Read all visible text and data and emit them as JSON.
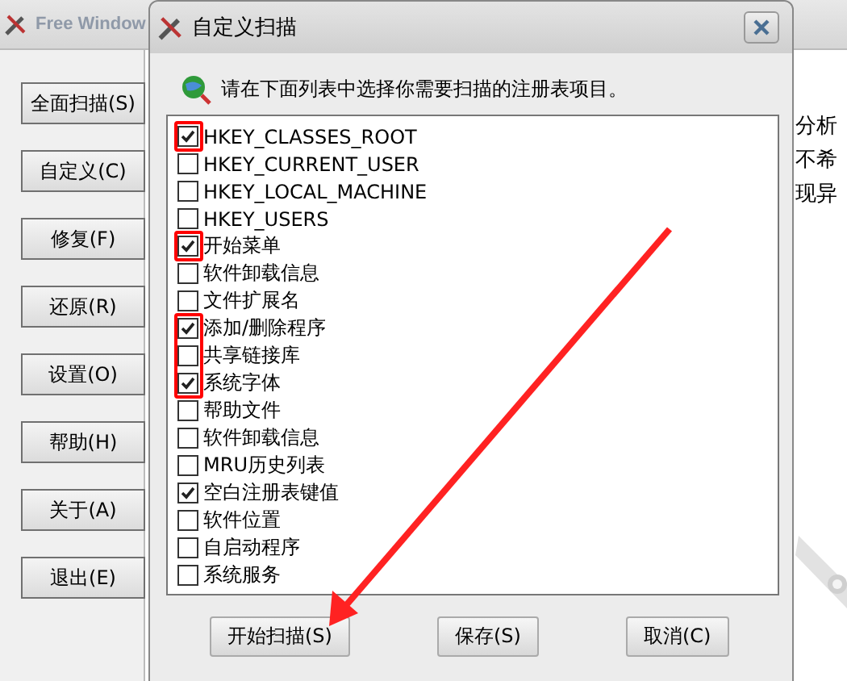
{
  "main_window": {
    "title": "Free Window",
    "buttons": [
      "全面扫描(S)",
      "自定义(C)",
      "修复(F)",
      "还原(R)",
      "设置(O)",
      "帮助(H)",
      "关于(A)",
      "退出(E)"
    ],
    "text_lines": [
      "分析",
      "不希",
      "现异"
    ]
  },
  "dialog": {
    "title": "自定义扫描",
    "instruction": "请在下面列表中选择你需要扫描的注册表项目。",
    "items": [
      {
        "label": "HKEY_CLASSES_ROOT",
        "checked": true,
        "highlighted": true
      },
      {
        "label": "HKEY_CURRENT_USER",
        "checked": false,
        "highlighted": false
      },
      {
        "label": "HKEY_LOCAL_MACHINE",
        "checked": false,
        "highlighted": false
      },
      {
        "label": "HKEY_USERS",
        "checked": false,
        "highlighted": false
      },
      {
        "label": "开始菜单",
        "checked": true,
        "highlighted": true
      },
      {
        "label": "软件卸载信息",
        "checked": false,
        "highlighted": false
      },
      {
        "label": "文件扩展名",
        "checked": false,
        "highlighted": false
      },
      {
        "label": "添加/删除程序",
        "checked": true,
        "highlighted": true
      },
      {
        "label": "共享链接库",
        "checked": false,
        "highlighted": true
      },
      {
        "label": "系统字体",
        "checked": true,
        "highlighted": true
      },
      {
        "label": "帮助文件",
        "checked": false,
        "highlighted": false
      },
      {
        "label": "软件卸载信息",
        "checked": false,
        "highlighted": false
      },
      {
        "label": "MRU历史列表",
        "checked": false,
        "highlighted": false
      },
      {
        "label": "空白注册表键值",
        "checked": true,
        "highlighted": false
      },
      {
        "label": "软件位置",
        "checked": false,
        "highlighted": false
      },
      {
        "label": "自启动程序",
        "checked": false,
        "highlighted": false
      },
      {
        "label": "系统服务",
        "checked": false,
        "highlighted": false
      }
    ],
    "buttons": [
      "开始扫描(S)",
      "保存(S)",
      "取消(C)"
    ]
  }
}
